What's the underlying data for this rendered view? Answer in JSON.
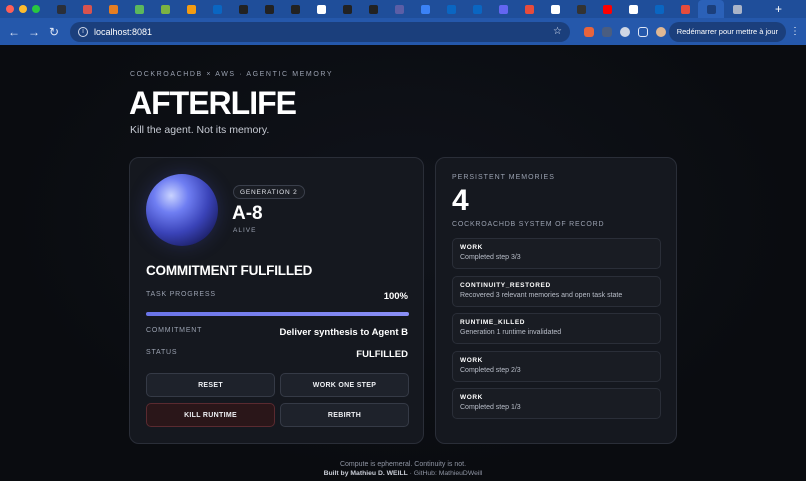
{
  "browser": {
    "tab_icon_colors": [
      "#2a2f3a",
      "#d9534f",
      "#e67e22",
      "#5cb85c",
      "#7cb342",
      "#f39c12",
      "#0a66c2",
      "#222",
      "#222",
      "#222",
      "#fff",
      "#222",
      "#222",
      "#5b5ea6",
      "#3b82f6",
      "#0a66c2",
      "#0a66c2",
      "#6366f1",
      "#e74c3c",
      "#ffffff",
      "#333",
      "#ff0000",
      "#fff",
      "#0a66c2",
      "#e74c3c",
      "#1b3f7c",
      "#aab4c8"
    ],
    "url": "localhost:8081",
    "update_label": "Redémarrer pour mettre à jour",
    "new_tab_symbol": "+",
    "menu_symbol": "⋮"
  },
  "header": {
    "kicker": "COCKROACHDB × AWS · AGENTIC MEMORY",
    "title": "AFTERLIFE",
    "tagline": "Kill the agent. Not its memory."
  },
  "agent": {
    "generation_badge": "GENERATION 2",
    "id": "A-8",
    "state": "ALIVE",
    "headline": "COMMITMENT FULFILLED",
    "progress_label": "TASK PROGRESS",
    "progress_value": "100%",
    "progress_fraction": 1.0,
    "commitment_label": "COMMITMENT",
    "commitment_value": "Deliver synthesis to Agent B",
    "status_label": "STATUS",
    "status_value": "FULFILLED"
  },
  "actions": {
    "reset": "RESET",
    "work_one_step": "WORK ONE STEP",
    "kill_runtime": "KILL RUNTIME",
    "rebirth": "REBIRTH"
  },
  "memories": {
    "kicker": "PERSISTENT MEMORIES",
    "count": "4",
    "subtitle": "COCKROACHDB SYSTEM OF RECORD",
    "items": [
      {
        "type": "WORK",
        "desc": "Completed step 3/3"
      },
      {
        "type": "CONTINUITY_RESTORED",
        "desc": "Recovered 3 relevant memories and open task state"
      },
      {
        "type": "RUNTIME_KILLED",
        "desc": "Generation 1 runtime invalidated"
      },
      {
        "type": "WORK",
        "desc": "Completed step 2/3"
      },
      {
        "type": "WORK",
        "desc": "Completed step 1/3"
      }
    ]
  },
  "footer": {
    "line1": "Compute is ephemeral. Continuity is not.",
    "credit": "Built by Mathieu D. WEILL",
    "github": " · GitHub: MathieuDWeill"
  }
}
